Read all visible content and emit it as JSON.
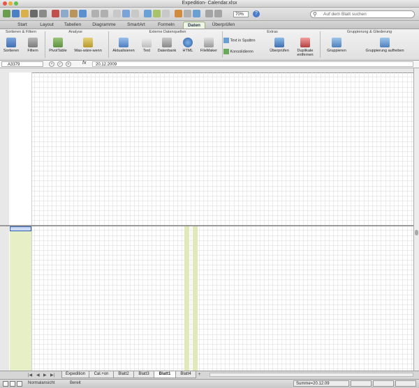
{
  "window": {
    "title": "Expedition- Calendar.xlsx"
  },
  "toolbar": {
    "zoom": "70%",
    "search_placeholder": "Auf dem Blatt suchen"
  },
  "tabs": [
    "Start",
    "Layout",
    "Tabellen",
    "Diagramme",
    "SmartArt",
    "Formeln",
    "Daten",
    "Überprüfen"
  ],
  "active_tab": "Daten",
  "ribbon": {
    "groups": [
      "Sortieren & Filtern",
      "Analyse",
      "Externe Datenquellen",
      "Extras",
      "Gruppierung & Gliederung"
    ],
    "buttons": {
      "sortieren": "Sortieren",
      "filtern": "Filtern",
      "pivottable": "PivotTable",
      "waswarewenn": "Was-wäre-wenn",
      "aktualisieren": "Aktualisieren",
      "text": "Text",
      "datenbank": "Datenbank",
      "html": "HTML",
      "filemaker": "FileMaker",
      "textinspalten": "Text in Spalten",
      "konsolidieren": "Konsolidieren",
      "uberprufen": "Überprüfen",
      "duplikate": "Duplikate entfernen",
      "gruppieren": "Gruppieren",
      "gruppierung_aufheben": "Gruppierung aufheben"
    }
  },
  "formula_bar": {
    "cell_ref": "A3379",
    "fx": "fx",
    "value": "20.12.2009"
  },
  "sheet_tabs": [
    "Expedition",
    "Cal.+on",
    "Blatt2",
    "Blatt3",
    "Blatt1",
    "Blatt4"
  ],
  "active_sheet": "Blatt1",
  "status": {
    "view": "Normalansicht",
    "ready": "Bereit",
    "sum": "Summe=20.12.09"
  }
}
